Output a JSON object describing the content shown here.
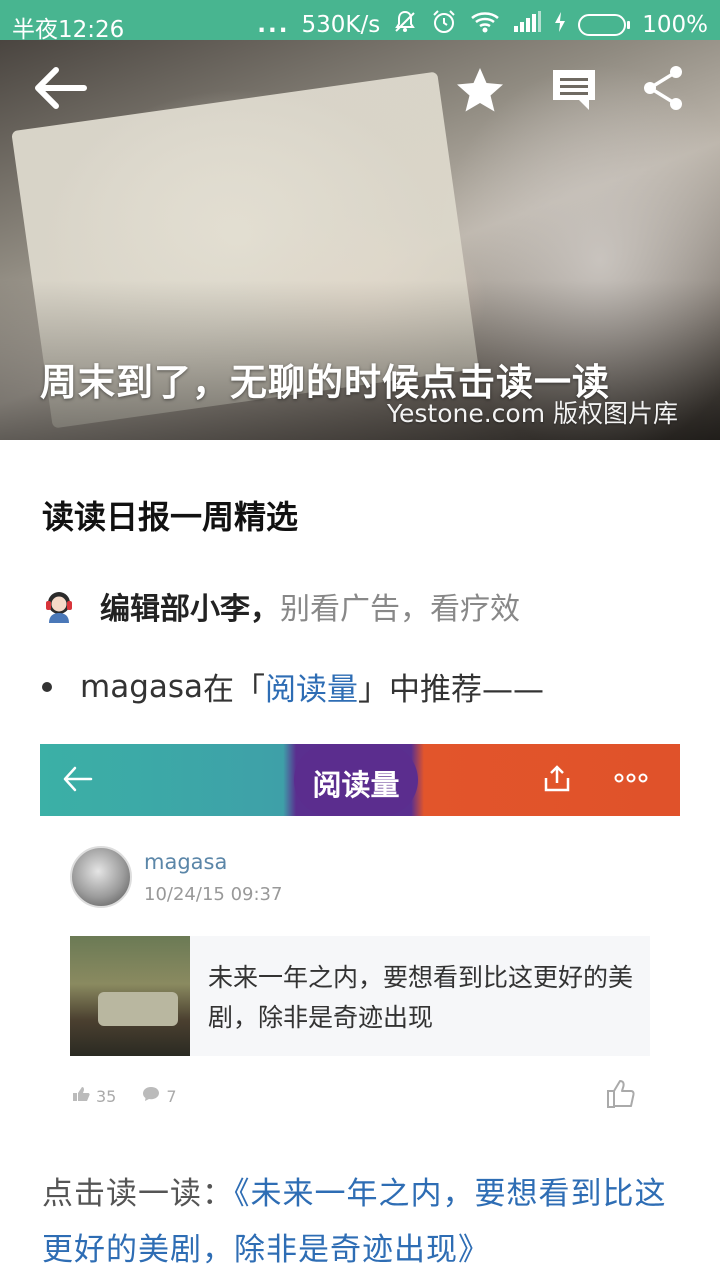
{
  "status": {
    "time": "半夜12:26",
    "dots": "...",
    "speed": "530K/s",
    "battery": "100%"
  },
  "hero": {
    "title": "周末到了，无聊的时候点击读一读",
    "credit": "Yestone.com 版权图片库"
  },
  "article": {
    "headline": "读读日报一周精选",
    "author": "编辑部小李，",
    "author_tag": "别看广告，看疗效",
    "bullet_user": "magasa",
    "bullet_pre": " 在「",
    "bullet_link": "阅读量",
    "bullet_post": "」中推荐——"
  },
  "embed": {
    "title": "阅读量",
    "user": "magasa",
    "date": "10/24/15 09:37",
    "card_text": "未来一年之内，要想看到比这更好的美剧，除非是奇迹出现",
    "likes": "35",
    "comments": "7"
  },
  "read": {
    "prefix": "点击读一读：",
    "link": "《未来一年之内，要想看到比这更好的美剧，除非是奇迹出现》"
  },
  "icons": {
    "toolbar": [
      "back-arrow-icon",
      "star-icon",
      "comment-icon",
      "share-icon"
    ]
  },
  "colors": {
    "status_bar": "#48b590",
    "link": "#2e6db4"
  }
}
